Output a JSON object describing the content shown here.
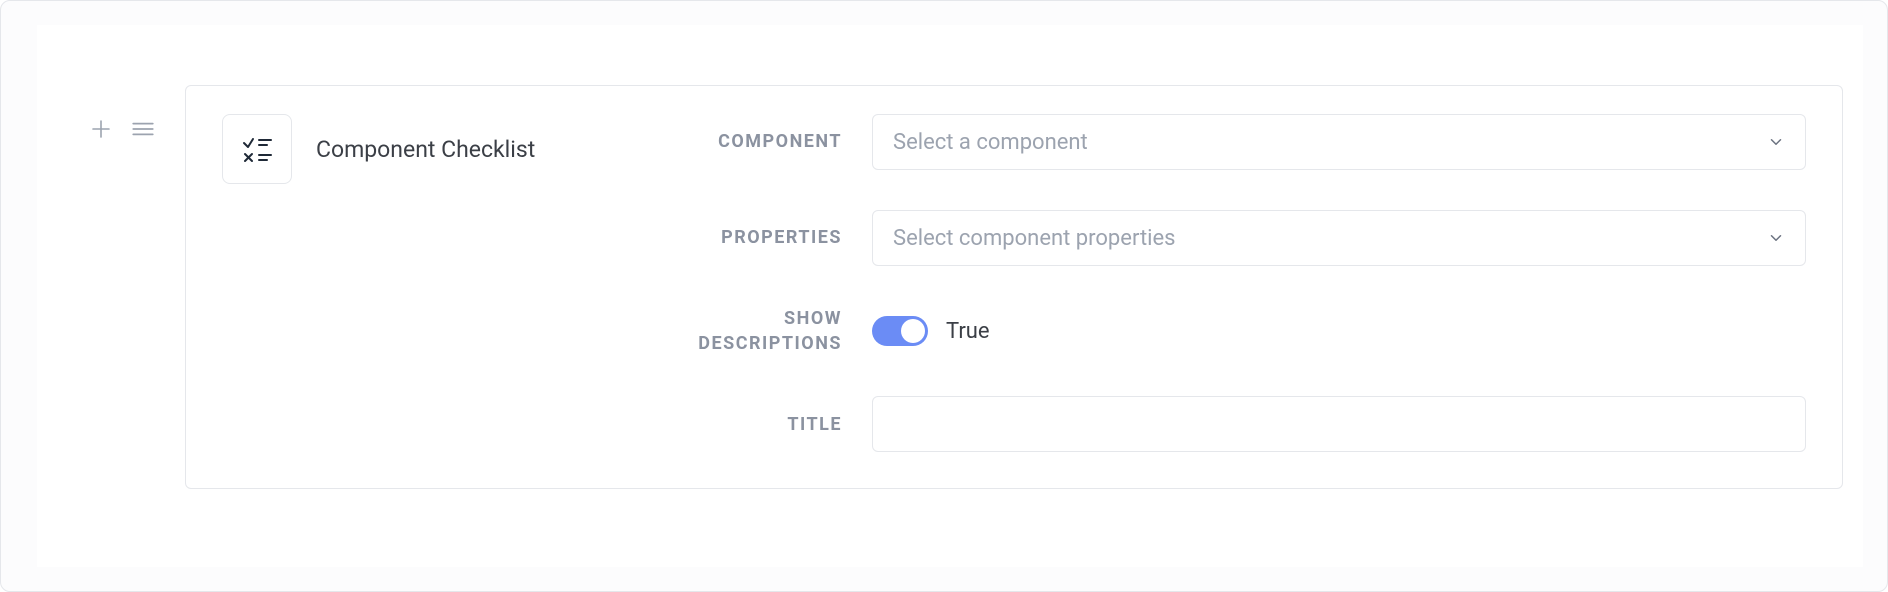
{
  "component": {
    "title": "Component Checklist"
  },
  "form": {
    "component": {
      "label": "Component",
      "placeholder": "Select a component"
    },
    "properties": {
      "label": "Properties",
      "placeholder": "Select component properties"
    },
    "show_descriptions": {
      "label": "Show Descriptions",
      "value_label": "True",
      "value": true
    },
    "title": {
      "label": "Title",
      "value": ""
    }
  }
}
